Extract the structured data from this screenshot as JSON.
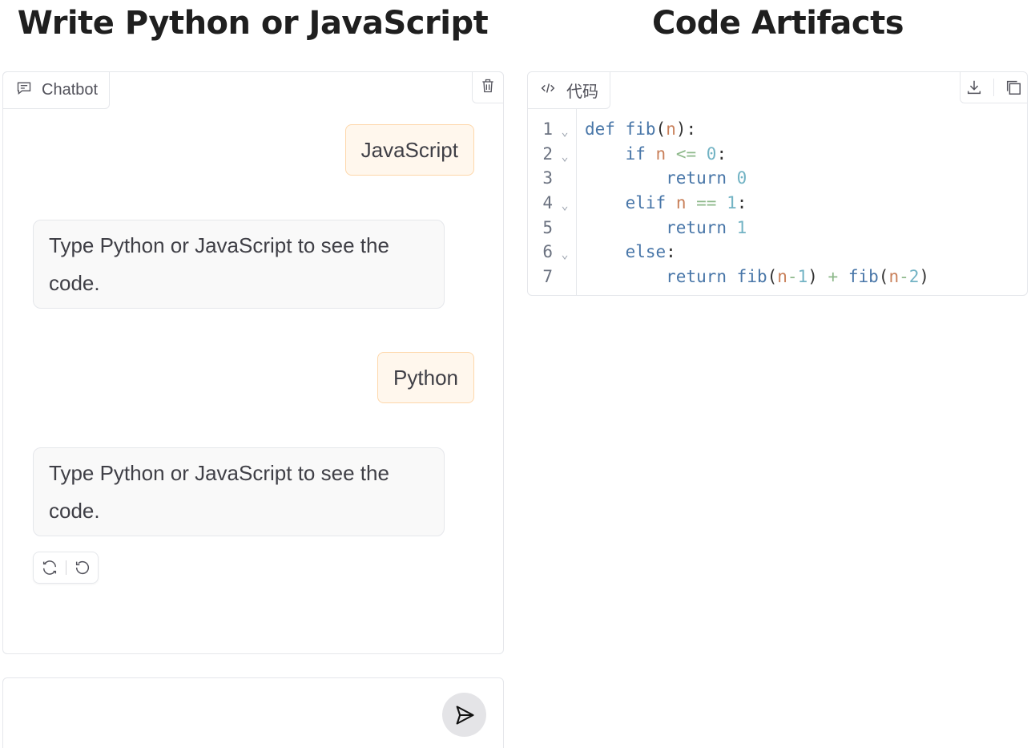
{
  "headings": {
    "left": "Write Python or JavaScript",
    "right": "Code Artifacts"
  },
  "chatbot": {
    "label": "Chatbot",
    "messages": [
      {
        "role": "user",
        "text": "JavaScript"
      },
      {
        "role": "bot",
        "text": "Type Python or JavaScript to see the code."
      },
      {
        "role": "user",
        "text": "Python"
      },
      {
        "role": "bot",
        "text": "Type Python or JavaScript to see the code."
      }
    ]
  },
  "input": {
    "value": "",
    "placeholder": ""
  },
  "code": {
    "label": "代码",
    "line_numbers": [
      "1",
      "2",
      "3",
      "4",
      "5",
      "6",
      "7"
    ],
    "fold_markers": [
      "⌄",
      "⌄",
      "",
      "⌄",
      "",
      "⌄",
      ""
    ],
    "lines": [
      "def fib(n):",
      "    if n <= 0:",
      "        return 0",
      "    elif n == 1:",
      "        return 1",
      "    else:",
      "        return fib(n-1) + fib(n-2)"
    ]
  },
  "icons": {
    "chatbot_label": "chat-icon",
    "clear": "trash-icon",
    "retry": "retry-icon",
    "undo": "undo-icon",
    "send": "send-icon",
    "code_label": "code-icon",
    "download": "download-icon",
    "copy": "copy-icon"
  },
  "colors": {
    "user_bubble": "#fff7ed",
    "user_bubble_border": "#fed7aa",
    "bot_bubble": "#f9f9f9",
    "keyword": "#4876a8",
    "variable": "#c9805a",
    "number": "#72b3c4"
  }
}
